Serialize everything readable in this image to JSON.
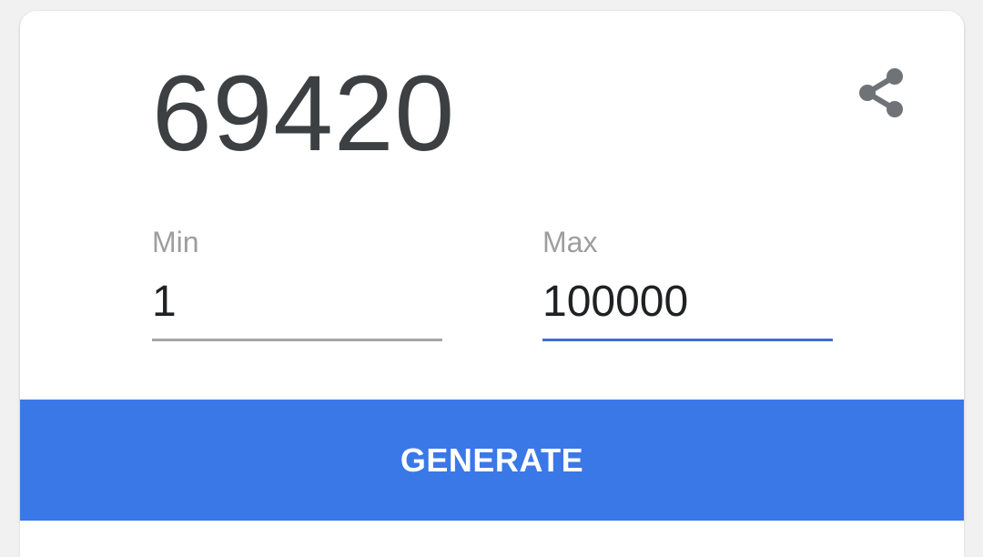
{
  "result": {
    "value": "69420"
  },
  "share": {
    "icon": "share-icon",
    "color": "#5f6368"
  },
  "min_field": {
    "label": "Min",
    "value": "1"
  },
  "max_field": {
    "label": "Max",
    "value": "100000"
  },
  "generate": {
    "label": "GENERATE",
    "color": "#3b78e7"
  }
}
